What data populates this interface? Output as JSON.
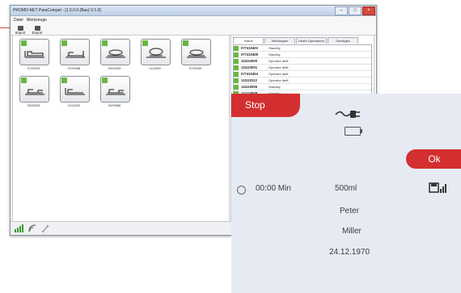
{
  "window": {
    "title": "PROMO-NET ParaCompet - [1.0.0.0 (Bau) V.1.0]",
    "menu": [
      "Datei",
      "Werkzeuge"
    ],
    "toolbar": [
      "Import",
      "Export"
    ]
  },
  "beds": [
    {
      "label": "0725033"
    },
    {
      "label": "0725088"
    },
    {
      "label": "0025533"
    },
    {
      "label": "1111000"
    },
    {
      "label": "0725039"
    },
    {
      "label": "0025003"
    },
    {
      "label": "0111000"
    },
    {
      "label": "0025556"
    }
  ],
  "right_pane": {
    "tabs": [
      "Status",
      "Meldungen",
      "Letzte Operatoren",
      "Sonstiges"
    ],
    "rows": [
      {
        "id": "077410402",
        "status": "Standby"
      },
      {
        "id": "077410408",
        "status": "Standby"
      },
      {
        "id": "111110000",
        "status": "Operator läuft"
      },
      {
        "id": "111110001",
        "status": "Operator läuft"
      },
      {
        "id": "077410404",
        "status": "Operator läuft"
      },
      {
        "id": "111110112",
        "status": "Operator läuft"
      },
      {
        "id": "111110006",
        "status": "Standby"
      },
      {
        "id": "111110008",
        "status": "Standby"
      }
    ]
  },
  "device": {
    "stop_label": "Stop",
    "ok_label": "Ok",
    "time": "00:00 Min",
    "volume": "500ml",
    "first_name": "Peter",
    "last_name": "Miller",
    "birth_date": "24.12.1970"
  },
  "colors": {
    "accent_red": "#d32f30",
    "status_green": "#69b640"
  },
  "icons": [
    "plug-icon",
    "battery-icon",
    "save-icon",
    "signal-icon",
    "wifi-icon",
    "pen-icon",
    "bed-icon"
  ]
}
